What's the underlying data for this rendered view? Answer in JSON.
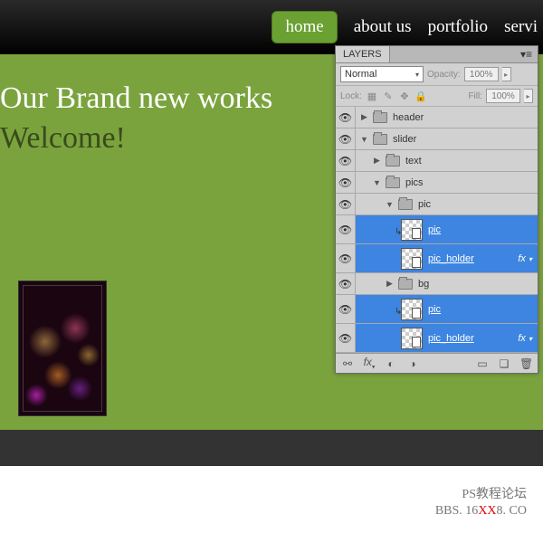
{
  "nav": {
    "items": [
      "home",
      "about us",
      "portfolio",
      "servi"
    ],
    "active_index": 0
  },
  "hero": {
    "line1": "Our Brand new works",
    "line2": "Welcome!"
  },
  "watermark": {
    "line1": "PS教程论坛",
    "line2_a": "BBS. 16",
    "line2_b": "XX",
    "line2_c": "8. CO"
  },
  "layers_panel": {
    "tab": "LAYERS",
    "blend_mode": "Normal",
    "opacity_label": "Opacity:",
    "opacity_value": "100%",
    "lock_label": "Lock:",
    "fill_label": "Fill:",
    "fill_value": "100%",
    "rows": [
      {
        "type": "group",
        "name": "header",
        "depth": 0,
        "expanded": false,
        "visible": true
      },
      {
        "type": "group",
        "name": "slider",
        "depth": 0,
        "expanded": true,
        "visible": true
      },
      {
        "type": "group",
        "name": "text",
        "depth": 1,
        "expanded": false,
        "visible": true
      },
      {
        "type": "group",
        "name": "pics",
        "depth": 1,
        "expanded": true,
        "visible": true
      },
      {
        "type": "group",
        "name": "pic",
        "depth": 2,
        "expanded": true,
        "visible": true
      },
      {
        "type": "layer",
        "name": "pic",
        "depth": 3,
        "visible": true,
        "clip": true,
        "selected": true
      },
      {
        "type": "layer",
        "name": "pic_holder",
        "depth": 3,
        "visible": true,
        "fx": true,
        "selected": true
      },
      {
        "type": "group",
        "name": "bg",
        "depth": 2,
        "expanded": false,
        "visible": true
      },
      {
        "type": "layer",
        "name": "pic",
        "depth": 3,
        "visible": true,
        "clip": true,
        "selected": true
      },
      {
        "type": "layer",
        "name": "pic_holder",
        "depth": 3,
        "visible": true,
        "fx": true,
        "selected": true
      }
    ]
  }
}
